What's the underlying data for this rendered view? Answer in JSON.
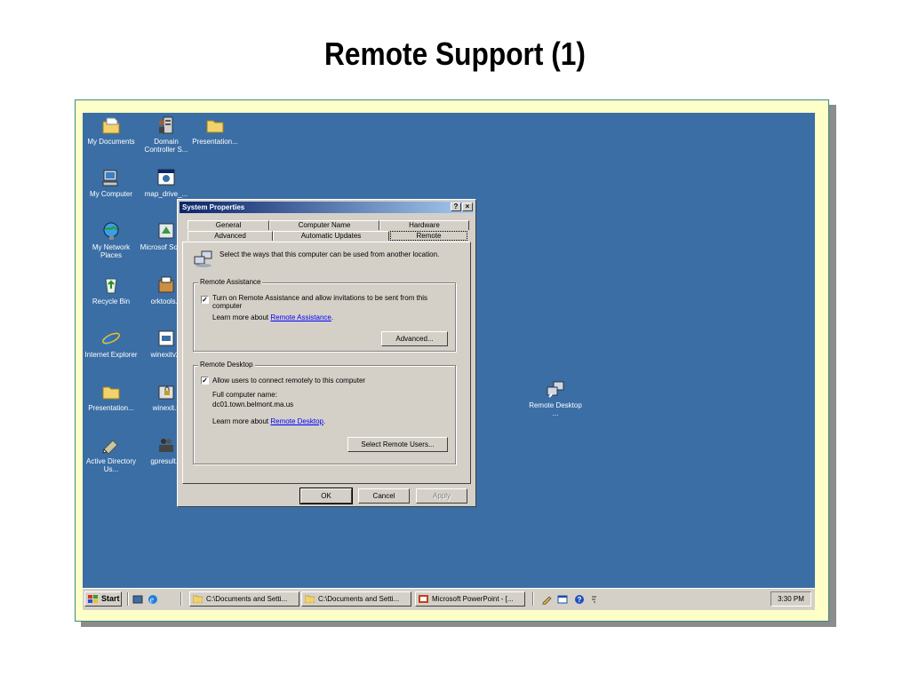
{
  "slide": {
    "title": "Remote Support (1)"
  },
  "desktop": {
    "icons": [
      {
        "label": "My Documents"
      },
      {
        "label": "Domain Controller S..."
      },
      {
        "label": "Presentation..."
      },
      {
        "label": "My Computer"
      },
      {
        "label": "map_drive_..."
      },
      {
        "label": "My Network Places"
      },
      {
        "label": "Microsof Softw..."
      },
      {
        "label": "Recycle Bin"
      },
      {
        "label": "orktools.e"
      },
      {
        "label": "Internet Explorer"
      },
      {
        "label": "winexitv2."
      },
      {
        "label": "Presentation..."
      },
      {
        "label": "winexit.s"
      },
      {
        "label": "Active Directory Us..."
      },
      {
        "label": "gpresult.e"
      },
      {
        "label": "Remote Desktop ..."
      }
    ]
  },
  "dialog": {
    "title": "System Properties",
    "help_btn": "?",
    "close_btn": "×",
    "tabs_row1": [
      "General",
      "Computer Name",
      "Hardware"
    ],
    "tabs_row2": [
      "Advanced",
      "Automatic Updates",
      "Remote"
    ],
    "intro": "Select the ways that this computer can be used from another location.",
    "remote_assistance": {
      "group_label": "Remote Assistance",
      "checkbox_label": "Turn on Remote Assistance and allow invitations to be sent from this computer",
      "checked": true,
      "learn_prefix": "Learn more about",
      "learn_link": "Remote Assistance",
      "learn_suffix": ".",
      "advanced_btn": "Advanced..."
    },
    "remote_desktop": {
      "group_label": "Remote Desktop",
      "checkbox_label": "Allow users to connect remotely to this computer",
      "checked": true,
      "full_name_label": "Full computer name:",
      "full_name_value": "dc01.town.belmont.ma.us",
      "learn_prefix": "Learn more about",
      "learn_link": "Remote Desktop",
      "learn_suffix": ".",
      "select_users_btn": "Select Remote Users..."
    },
    "ok_btn": "OK",
    "cancel_btn": "Cancel",
    "apply_btn": "Apply"
  },
  "taskbar": {
    "start_label": "Start",
    "tasks": [
      {
        "label": "C:\\Documents and Setti..."
      },
      {
        "label": "C:\\Documents and Setti..."
      },
      {
        "label": "Microsoft PowerPoint - [..."
      }
    ],
    "clock": "3:30 PM"
  },
  "colors": {
    "desktop_bg": "#3a6ea5",
    "frame_bg": "#ffffc8",
    "title_bar": "#0a246a"
  }
}
